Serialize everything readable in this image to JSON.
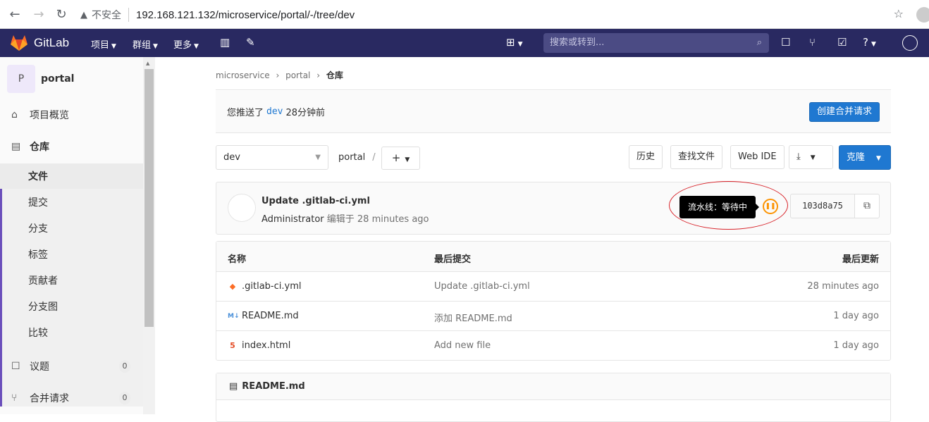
{
  "browser": {
    "insecure_label": "不安全",
    "url": "192.168.121.132/microservice/portal/-/tree/dev"
  },
  "topnav": {
    "brand": "GitLab",
    "projects": "项目",
    "groups": "群组",
    "more": "更多",
    "search_placeholder": "搜索或转到..."
  },
  "sidebar": {
    "project_initial": "P",
    "project_name": "portal",
    "overview": "项目概览",
    "repository": "仓库",
    "repo_items": [
      "文件",
      "提交",
      "分支",
      "标签",
      "贡献者",
      "分支图",
      "比较"
    ],
    "issues": "议题",
    "issues_count": "0",
    "merge_requests": "合并请求",
    "mr_count": "0"
  },
  "breadcrumb": {
    "group": "microservice",
    "project": "portal",
    "current": "仓库"
  },
  "push_notice": {
    "prefix": "您推送了",
    "branch": "dev",
    "time": "28分钟前",
    "button": "创建合并请求"
  },
  "toolbar": {
    "branch": "dev",
    "path": "portal",
    "slash": "/",
    "add": "+",
    "history": "历史",
    "find_file": "查找文件",
    "web_ide": "Web IDE",
    "clone": "克隆"
  },
  "last_commit": {
    "title": "Update .gitlab-ci.yml",
    "author": "Administrator",
    "meta": "编辑于 28 minutes ago",
    "tooltip": "流水线：等待中",
    "sha": "103d8a75"
  },
  "files": {
    "headers": {
      "name": "名称",
      "last_commit": "最后提交",
      "last_update": "最后更新"
    },
    "rows": [
      {
        "name": ".gitlab-ci.yml",
        "message": "Update .gitlab-ci.yml",
        "updated": "28 minutes ago",
        "icon": "gitlab-icon"
      },
      {
        "name": "README.md",
        "message": "添加 README.md",
        "updated": "1 day ago",
        "icon": "markdown-icon"
      },
      {
        "name": "index.html",
        "message": "Add new file",
        "updated": "1 day ago",
        "icon": "html5-icon"
      }
    ]
  },
  "readme": {
    "title": "README.md"
  },
  "colors": {
    "nav_bg": "#292961",
    "primary": "#1f78d1",
    "pending": "#fc9403",
    "annotation": "#d8232a"
  }
}
